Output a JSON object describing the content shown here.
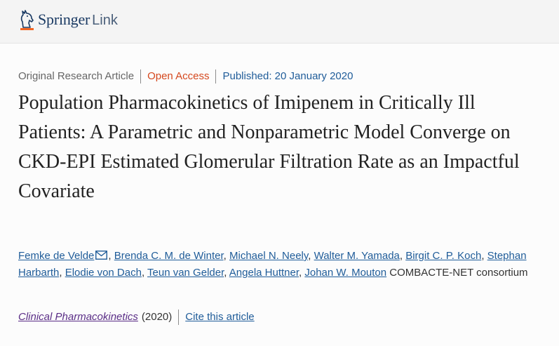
{
  "header": {
    "logo_springer": "Springer",
    "logo_link": "Link"
  },
  "article": {
    "type": "Original Research Article",
    "access": "Open Access",
    "published": "Published: 20 January 2020",
    "title": "Population Pharmacokinetics of Imipenem in Critically Ill Patients: A Parametric and Nonparametric Model Converge on CKD-EPI Estimated Glomerular Filtration Rate as an Impactful Covariate",
    "authors": [
      "Femke de Velde",
      "Brenda C. M. de Winter",
      "Michael N. Neely",
      "Walter M. Yamada",
      "Birgit C. P. Koch",
      "Stephan Harbarth",
      "Elodie von Dach",
      "Teun van Gelder",
      "Angela Huttner",
      "Johan W. Mouton"
    ],
    "consortium": "COMBACTE-NET consortium",
    "journal": "Clinical Pharmacokinetics",
    "year": "(2020)",
    "cite": "Cite this article"
  },
  "icons": {
    "logo": "springer-horse-icon",
    "corresponding_author": "mail-icon"
  },
  "colors": {
    "open_access": "#d5481e",
    "link": "#1f5c99",
    "journal_link": "#5a2d86",
    "brand": "#1a3a63"
  }
}
